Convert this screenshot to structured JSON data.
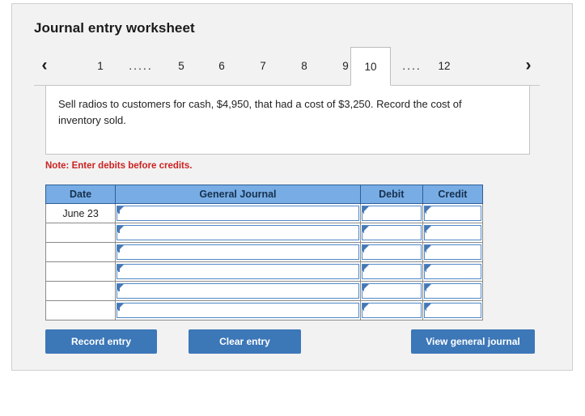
{
  "page": {
    "title": "Journal entry worksheet"
  },
  "tabs": {
    "prev_icon": "‹",
    "next_icon": "›",
    "items": [
      {
        "label": "1",
        "type": "number",
        "active": false
      },
      {
        "label": ".....",
        "type": "ellipsis",
        "active": false
      },
      {
        "label": "5",
        "type": "number",
        "active": false
      },
      {
        "label": "6",
        "type": "number",
        "active": false
      },
      {
        "label": "7",
        "type": "number",
        "active": false
      },
      {
        "label": "8",
        "type": "number",
        "active": false
      },
      {
        "label": "9",
        "type": "number",
        "active": false
      },
      {
        "label": "10",
        "type": "number",
        "active": true
      },
      {
        "label": "....",
        "type": "ellipsis",
        "active": false
      },
      {
        "label": "12",
        "type": "number",
        "active": false
      }
    ]
  },
  "description": {
    "text": "Sell radios to customers for cash, $4,950, that had a cost of $3,250. Record the cost of inventory sold."
  },
  "note": {
    "text": "Note: Enter debits before credits."
  },
  "table": {
    "headers": [
      "Date",
      "General Journal",
      "Debit",
      "Credit"
    ],
    "rows": [
      {
        "date": "June 23",
        "general_journal": "",
        "debit": "",
        "credit": ""
      },
      {
        "date": "",
        "general_journal": "",
        "debit": "",
        "credit": ""
      },
      {
        "date": "",
        "general_journal": "",
        "debit": "",
        "credit": ""
      },
      {
        "date": "",
        "general_journal": "",
        "debit": "",
        "credit": ""
      },
      {
        "date": "",
        "general_journal": "",
        "debit": "",
        "credit": ""
      },
      {
        "date": "",
        "general_journal": "",
        "debit": "",
        "credit": ""
      }
    ]
  },
  "buttons": {
    "record": "Record entry",
    "clear": "Clear entry",
    "view": "View general journal"
  },
  "colors": {
    "panel_bg": "#f2f2f2",
    "header_blue": "#78ace4",
    "button_blue": "#3c77b8",
    "note_red": "#cc2222",
    "cell_border_blue": "#4f88c6"
  }
}
